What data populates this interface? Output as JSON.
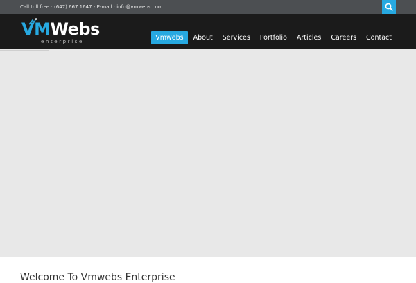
{
  "topbar": {
    "contact_text": "Call toll free : (647) 667 1647 - E-mail : info@vmwebs.com",
    "search_icon": "search-icon"
  },
  "logo": {
    "letter_v": "V",
    "letter_m": "M",
    "word": "Webs",
    "tagline": "enterprise"
  },
  "nav": {
    "items": [
      {
        "label": "Vmwebs",
        "active": true
      },
      {
        "label": "About",
        "active": false
      },
      {
        "label": "Services",
        "active": false
      },
      {
        "label": "Portfolio",
        "active": false
      },
      {
        "label": "Articles",
        "active": false
      },
      {
        "label": "Careers",
        "active": false
      },
      {
        "label": "Contact",
        "active": false
      }
    ]
  },
  "main": {
    "welcome_heading": "Welcome To Vmwebs Enterprise"
  },
  "colors": {
    "accent": "#27a9e1",
    "topbar_bg": "#4c4f52",
    "header_bg": "#1b1b1b",
    "hero_bg": "#e8e8e8"
  }
}
